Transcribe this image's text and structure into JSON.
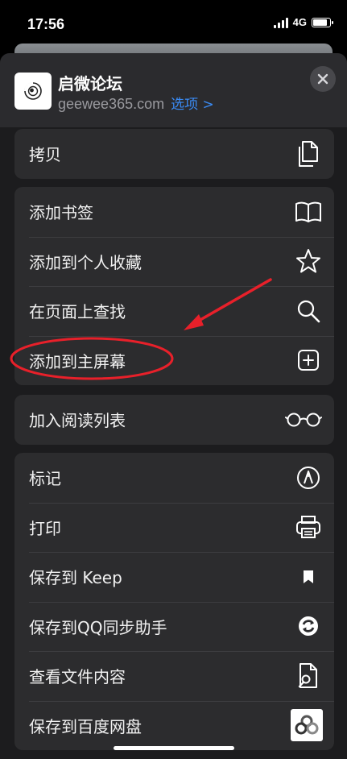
{
  "status_bar": {
    "time": "17:56",
    "network": "4G"
  },
  "site": {
    "title": "启微论坛",
    "domain": "geewee365.com",
    "options_label": "选项 >"
  },
  "groups": [
    {
      "items": [
        {
          "label": "拷贝",
          "icon": "copy-icon"
        }
      ]
    },
    {
      "items": [
        {
          "label": "添加书签",
          "icon": "book-icon"
        },
        {
          "label": "添加到个人收藏",
          "icon": "star-icon"
        },
        {
          "label": "在页面上查找",
          "icon": "search-icon"
        },
        {
          "label": "添加到主屏幕",
          "icon": "add-square-icon"
        }
      ]
    },
    {
      "items": [
        {
          "label": "加入阅读列表",
          "icon": "glasses-icon"
        }
      ]
    },
    {
      "items": [
        {
          "label": "标记",
          "icon": "markup-icon"
        },
        {
          "label": "打印",
          "icon": "printer-icon"
        },
        {
          "label": "保存到 Keep",
          "icon": "bookmark-icon"
        },
        {
          "label": "保存到QQ同步助手",
          "icon": "sync-icon"
        },
        {
          "label": "查看文件内容",
          "icon": "file-search-icon"
        },
        {
          "label": "保存到百度网盘",
          "icon": "baidu-netdisk-icon"
        }
      ]
    }
  ],
  "colors": {
    "sheet": "#1c1c1e",
    "group": "#2c2c2e",
    "link": "#3a8bf5",
    "annotation": "#e8202a"
  }
}
